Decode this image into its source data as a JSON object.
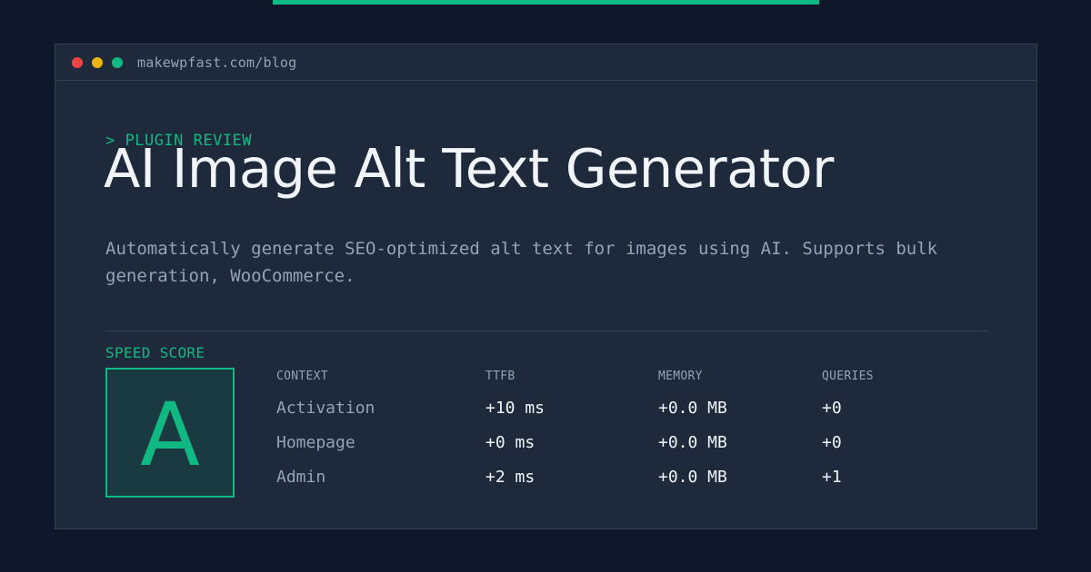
{
  "window": {
    "url": "makewpfast.com/blog"
  },
  "article": {
    "kicker": "> PLUGIN REVIEW",
    "title": "AI Image Alt Text Generator",
    "description": "Automatically generate SEO-optimized alt text for images using AI. Supports bulk generation, WooCommerce."
  },
  "score": {
    "label": "SPEED SCORE",
    "grade": "A"
  },
  "metrics": {
    "headers": [
      "CONTEXT",
      "TTFB",
      "MEMORY",
      "QUERIES"
    ],
    "rows": [
      {
        "context": "Activation",
        "ttfb": "+10 ms",
        "memory": "+0.0 MB",
        "queries": "+0"
      },
      {
        "context": "Homepage",
        "ttfb": "+0 ms",
        "memory": "+0.0 MB",
        "queries": "+0"
      },
      {
        "context": "Admin",
        "ttfb": "+2 ms",
        "memory": "+0.0 MB",
        "queries": "+1"
      }
    ]
  },
  "colors": {
    "accent": "#10b981",
    "background": "#0f172a",
    "panel": "#1e293b",
    "close_dot": "#ef4444",
    "minimize_dot": "#eab308",
    "maximize_dot": "#10b981"
  }
}
